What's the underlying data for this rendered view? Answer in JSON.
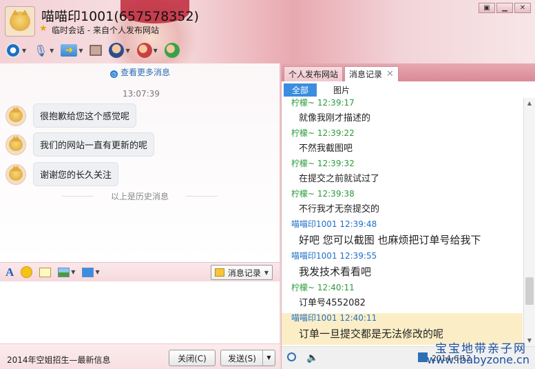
{
  "header": {
    "title": "喵喵印1001(657578352)",
    "subtitle": "临时会话 - 来自个人发布网站"
  },
  "window_controls": [
    "▣",
    "▁",
    "✕"
  ],
  "chat": {
    "more_link": "查看更多消息",
    "time": "13:07:39",
    "messages": [
      "很抱歉给您这个感觉呢",
      "我们的网站一直有更新的呢",
      "谢谢您的长久关注"
    ],
    "separator": "以上是历史消息"
  },
  "input_toolbar": {
    "font_icon": "A",
    "history_button": "消息记录"
  },
  "bottom_bar": {
    "ad_text": "2014年空姐招生—最新信息",
    "close_button": "关闭(C)",
    "send_button": "发送(S)"
  },
  "right_panel": {
    "tabs": [
      "个人发布网站",
      "消息记录"
    ],
    "filters": [
      "全部",
      "图片"
    ],
    "log": [
      {
        "head": "柠檬~ 12:39:17",
        "body": "就像我刚才描述的",
        "who": "green"
      },
      {
        "head": "柠檬~ 12:39:22",
        "body": "不然我截图吧",
        "who": "green"
      },
      {
        "head": "柠檬~ 12:39:32",
        "body": "在提交之前就试过了",
        "who": "green"
      },
      {
        "head": "柠檬~ 12:39:38",
        "body": "不行我才无奈提交的",
        "who": "green"
      },
      {
        "head": "喵喵印1001 12:39:48",
        "body": "好吧 您可以截图 也麻烦把订单号给我下",
        "who": "blue"
      },
      {
        "head": "喵喵印1001 12:39:55",
        "body": "我发技术看看吧",
        "who": "blue"
      },
      {
        "head": "柠檬~ 12:40:11",
        "body": "订单号4552082",
        "who": "green"
      },
      {
        "head": "喵喵印1001 12:40:11",
        "body": "订单一旦提交都是无法修改的呢",
        "who": "blue"
      }
    ],
    "date_partial": "2014-6-12"
  },
  "watermark": {
    "line1": "宝宝地带亲子网",
    "line2": "www.ibabyzone.cn"
  }
}
